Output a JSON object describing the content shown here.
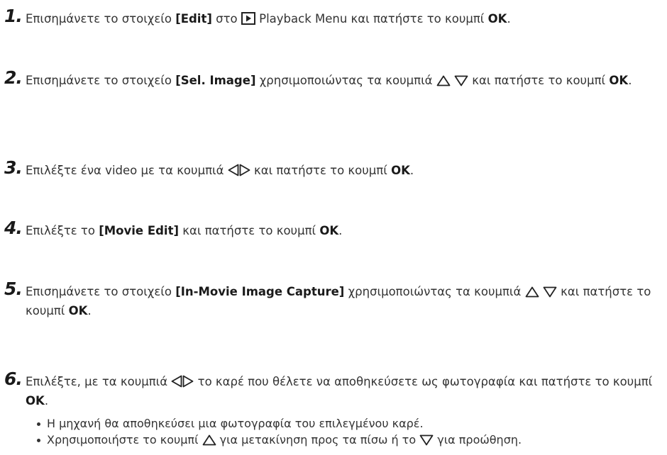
{
  "steps": [
    {
      "number": "1.",
      "parts": {
        "a": "Επισημάνετε το στοιχείο ",
        "item": "[Edit]",
        "b": " στο ",
        "c": " Playback Menu και πατήστε το κουμπί ",
        "ok": "OK",
        "d": "."
      }
    },
    {
      "number": "2.",
      "parts": {
        "a": "Επισημάνετε το στοιχείο ",
        "item": "[Sel. Image]",
        "b": " χρησιμοποιώντας τα κουμπιά ",
        "c": " και πατήστε το κουμπί ",
        "ok": "OK",
        "d": "."
      }
    },
    {
      "number": "3.",
      "parts": {
        "a": "Επιλέξτε ένα video με τα κουμπιά ",
        "b": " και πατήστε το κουμπί ",
        "ok": "OK",
        "d": "."
      }
    },
    {
      "number": "4.",
      "parts": {
        "a": "Επιλέξτε το ",
        "item": "[Movie Edit]",
        "b": " και πατήστε το κουμπί ",
        "ok": "OK",
        "d": "."
      }
    },
    {
      "number": "5.",
      "parts": {
        "a": "Επισημάνετε το στοιχείο ",
        "item": "[In-Movie Image Capture]",
        "b": " χρησιμοποιώντας τα κουμπιά ",
        "c": " και πατήστε το κουμπί ",
        "ok": "OK",
        "d": "."
      }
    },
    {
      "number": "6.",
      "parts": {
        "a": "Επιλέξτε, με τα κουμπιά ",
        "b": " το καρέ που θέλετε να αποθηκεύσετε ως φωτογραφία και πατήστε το κουμπί ",
        "ok": "OK",
        "d": "."
      },
      "bullets": [
        {
          "text": "Η μηχανή θα αποθηκεύσει μια φωτογραφία του επιλεγμένου καρέ."
        },
        {
          "a": "Χρησιμοποιήστε το κουμπί ",
          "b": " για μετακίνηση προς τα πίσω ή το ",
          "c": " για προώθηση."
        }
      ]
    }
  ],
  "icons": {
    "playback": "playback-menu-icon",
    "up": "up-triangle-icon",
    "down": "down-triangle-icon",
    "left": "left-triangle-icon",
    "right": "right-triangle-icon"
  }
}
